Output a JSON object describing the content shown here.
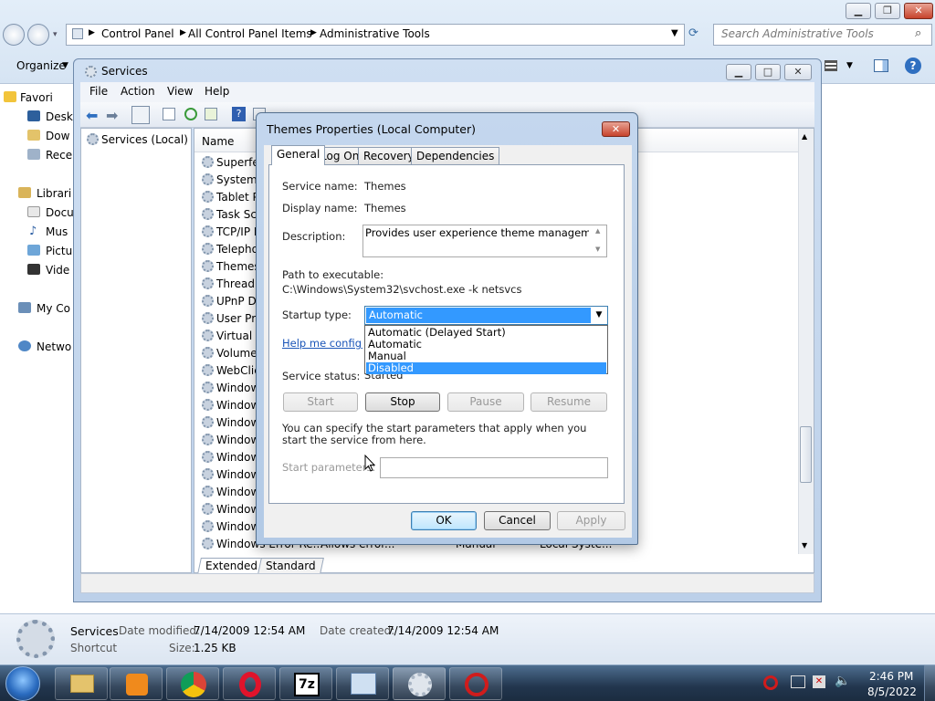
{
  "explorer": {
    "breadcrumb": [
      "Control Panel",
      "All Control Panel Items",
      "Administrative Tools"
    ],
    "search_placeholder": "Search Administrative Tools",
    "organize_label": "Organize",
    "nav": [
      {
        "label": "Favorites",
        "icon": "star-icon"
      },
      {
        "label": "Desktop",
        "icon": "desktop-icon"
      },
      {
        "label": "Downloads",
        "icon": "folder-icon"
      },
      {
        "label": "Recent Places",
        "icon": "recent-icon"
      },
      {
        "label": "Libraries",
        "icon": "library-icon"
      },
      {
        "label": "Documents",
        "icon": "document-icon"
      },
      {
        "label": "Music",
        "icon": "music-icon"
      },
      {
        "label": "Pictures",
        "icon": "picture-icon"
      },
      {
        "label": "Videos",
        "icon": "video-icon"
      },
      {
        "label": "My Computer",
        "icon": "computer-icon"
      },
      {
        "label": "Network",
        "icon": "network-icon"
      }
    ],
    "nav_visible": [
      "Favori",
      "Desk",
      "Dow",
      "Rece",
      "Librari",
      "Docu",
      "Mus",
      "Pictu",
      "Vide",
      "My Co",
      "Netwo"
    ],
    "details": {
      "name": "Services",
      "type": "Shortcut",
      "modified_label": "Date modified:",
      "modified": "7/14/2009 12:54 AM",
      "created_label": "Date created:",
      "created": "7/14/2009 12:54 AM",
      "size_label": "Size:",
      "size": "1.25 KB"
    }
  },
  "services": {
    "title": "Services",
    "menu": [
      "File",
      "Action",
      "View",
      "Help"
    ],
    "tree_item": "Services (Local)",
    "column_name": "Name",
    "rows": [
      "Superfet",
      "System I",
      "Tablet P",
      "Task Sch",
      "TCP/IP I",
      "Telephor",
      "Themes",
      "Thread (",
      "UPnP De",
      "User Pro",
      "Virtual D",
      "Volume",
      "WebClie",
      "Window",
      "Window",
      "Window",
      "Window",
      "Window",
      "Window",
      "Window",
      "Window",
      "Window"
    ],
    "last_row": {
      "name": "Windows Error Re...",
      "desc": "Allows error...",
      "startup": "Manual",
      "logon": "Local Syste..."
    },
    "tabs": [
      "Extended",
      "Standard"
    ]
  },
  "dialog": {
    "title": "Themes Properties (Local Computer)",
    "tabs": [
      "General",
      "Log On",
      "Recovery",
      "Dependencies"
    ],
    "service_name_label": "Service name:",
    "service_name": "Themes",
    "display_name_label": "Display name:",
    "display_name": "Themes",
    "description_label": "Description:",
    "description": "Provides user experience theme management.",
    "path_label": "Path to executable:",
    "path": "C:\\Windows\\System32\\svchost.exe -k netsvcs",
    "startup_label": "Startup type:",
    "startup_value": "Automatic",
    "startup_options": [
      "Automatic (Delayed Start)",
      "Automatic",
      "Manual",
      "Disabled"
    ],
    "startup_highlighted": "Disabled",
    "help_link": "Help me configure",
    "status_label": "Service status:",
    "status_value": "Started",
    "buttons": {
      "start": "Start",
      "stop": "Stop",
      "pause": "Pause",
      "resume": "Resume"
    },
    "params_note": "You can specify the start parameters that apply when you start the service from here.",
    "params_label": "Start parameters:",
    "ok": "OK",
    "cancel": "Cancel",
    "apply": "Apply"
  },
  "taskbar": {
    "time": "2:46 PM",
    "date": "8/5/2022",
    "apps": [
      "explorer-icon",
      "media-player-icon",
      "chrome-icon",
      "opera-icon",
      "7zip-icon",
      "control-panel-icon",
      "services-icon",
      "recorder-icon"
    ]
  }
}
